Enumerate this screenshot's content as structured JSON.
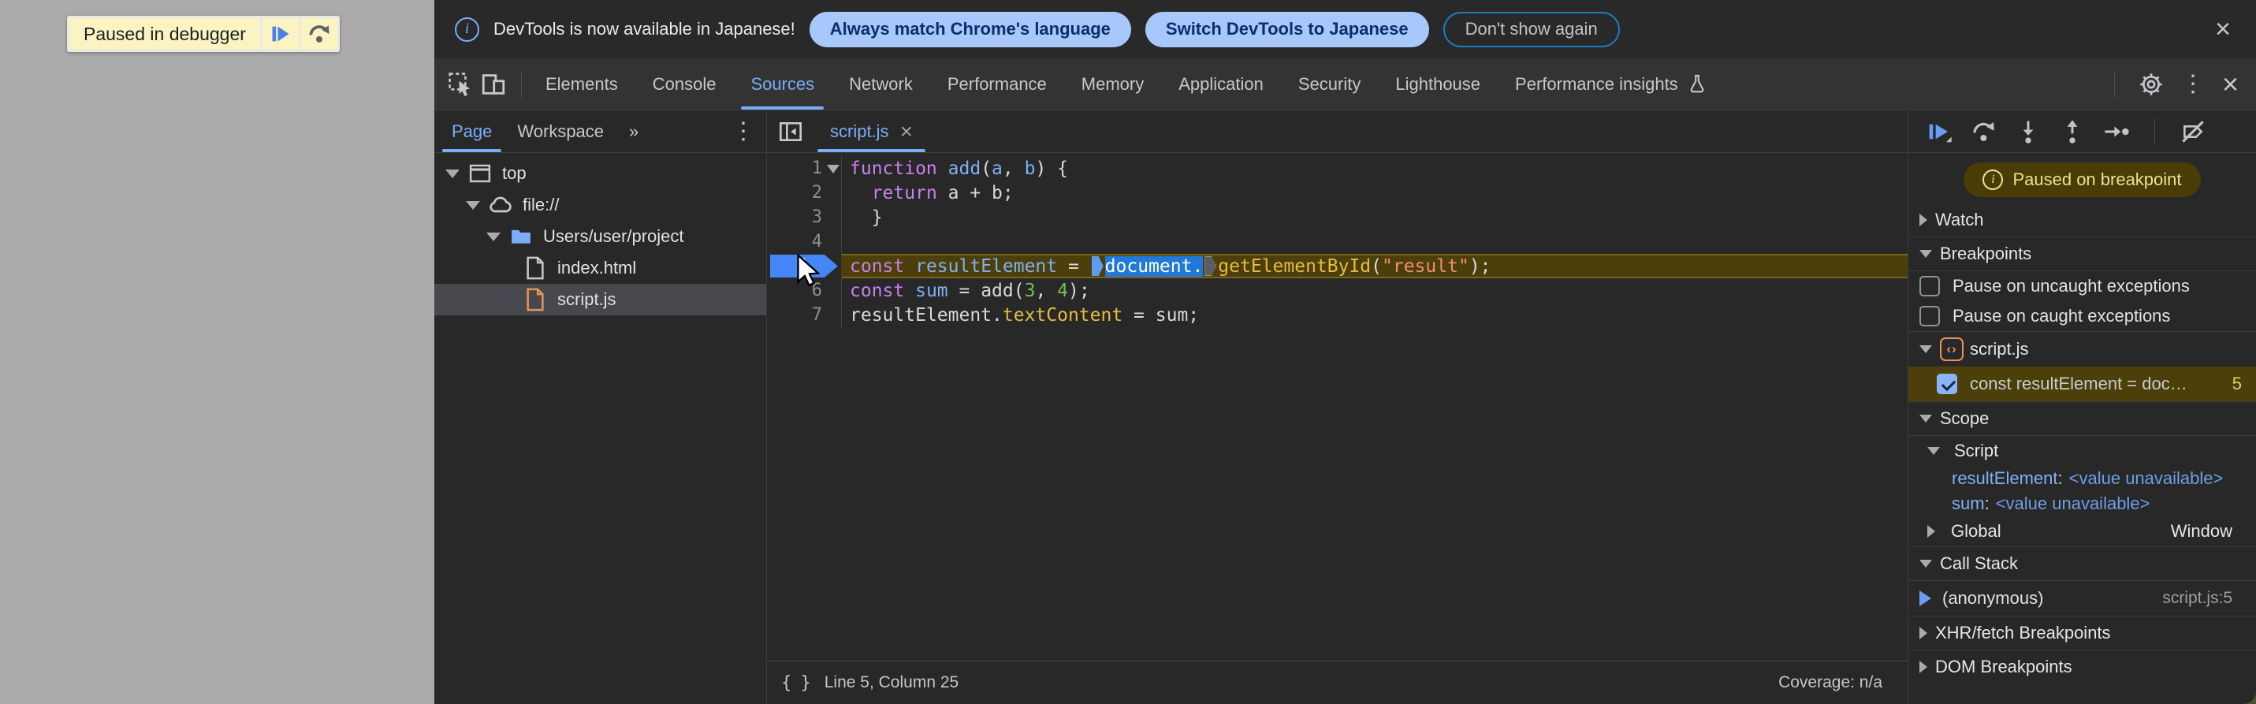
{
  "overlay": {
    "label": "Paused in debugger"
  },
  "infobar": {
    "message": "DevTools is now available in Japanese!",
    "primary_button": "Always match Chrome's language",
    "secondary_button": "Switch DevTools to Japanese",
    "dismiss_button": "Don't show again",
    "close": "×"
  },
  "toolbar": {
    "tabs": [
      "Elements",
      "Console",
      "Sources",
      "Network",
      "Performance",
      "Memory",
      "Application",
      "Security",
      "Lighthouse",
      "Performance insights"
    ],
    "active_tab": "Sources"
  },
  "nav": {
    "page_tab": "Page",
    "workspace_tab": "Workspace",
    "more_tabs": "»",
    "tree": [
      {
        "label": "top",
        "icon": "frame-icon",
        "depth": 0,
        "caret": true,
        "selected": false
      },
      {
        "label": "file://",
        "icon": "cloud-icon",
        "depth": 1,
        "caret": true,
        "selected": false
      },
      {
        "label": "Users/user/project",
        "icon": "folder-icon",
        "depth": 2,
        "caret": true,
        "selected": false
      },
      {
        "label": "index.html",
        "icon": "file-html-icon",
        "depth": 3,
        "caret": false,
        "selected": false
      },
      {
        "label": "script.js",
        "icon": "file-js-icon",
        "depth": 3,
        "caret": false,
        "selected": true
      }
    ]
  },
  "editor": {
    "tab_label": "script.js",
    "status_left": "Line 5, Column 25",
    "status_right": "Coverage: n/a",
    "paused_line": 5,
    "lines": [
      {
        "n": 1,
        "fold": true,
        "paused": false,
        "tokens": [
          [
            "kw",
            "function"
          ],
          [
            "pl",
            " "
          ],
          [
            "def",
            "add"
          ],
          [
            "pl",
            "("
          ],
          [
            "def",
            "a"
          ],
          [
            "pl",
            ", "
          ],
          [
            "def",
            "b"
          ],
          [
            "pl",
            ") {"
          ]
        ]
      },
      {
        "n": 2,
        "fold": false,
        "paused": false,
        "tokens": [
          [
            "pl",
            "  "
          ],
          [
            "kw",
            "return"
          ],
          [
            "pl",
            " a + b;"
          ]
        ]
      },
      {
        "n": 3,
        "fold": false,
        "paused": false,
        "tokens": [
          [
            "pl",
            "  }"
          ]
        ]
      },
      {
        "n": 4,
        "fold": false,
        "paused": false,
        "tokens": []
      },
      {
        "n": 5,
        "fold": false,
        "paused": true,
        "tokens": [
          [
            "kw",
            "const"
          ],
          [
            "pl",
            " "
          ],
          [
            "def",
            "resultElement"
          ],
          [
            "pl",
            " = "
          ],
          [
            "m1",
            ""
          ],
          [
            "sel",
            "document."
          ],
          [
            "m2",
            ""
          ],
          [
            "fn",
            "getElementById"
          ],
          [
            "pl",
            "("
          ],
          [
            "str",
            "\"result\""
          ],
          [
            "pl",
            ");"
          ]
        ]
      },
      {
        "n": 6,
        "fold": false,
        "paused": false,
        "tokens": [
          [
            "kw",
            "const"
          ],
          [
            "pl",
            " "
          ],
          [
            "def",
            "sum"
          ],
          [
            "pl",
            " = add("
          ],
          [
            "num",
            "3"
          ],
          [
            "pl",
            ", "
          ],
          [
            "num",
            "4"
          ],
          [
            "pl",
            ");"
          ]
        ]
      },
      {
        "n": 7,
        "fold": false,
        "paused": false,
        "tokens": [
          [
            "pl",
            "resultElement."
          ],
          [
            "fn",
            "textContent"
          ],
          [
            "pl",
            " = sum;"
          ]
        ]
      }
    ]
  },
  "debugger": {
    "paused_badge": "Paused on breakpoint",
    "watch_label": "Watch",
    "breakpoints_label": "Breakpoints",
    "uncaught_label": "Pause on uncaught exceptions",
    "caught_label": "Pause on caught exceptions",
    "bp_file": "script.js",
    "bp_entry": "const resultElement = doc…",
    "bp_line": "5",
    "scope_label": "Scope",
    "script_scope_label": "Script",
    "vars": [
      {
        "name": "resultElement",
        "value": "<value unavailable>"
      },
      {
        "name": "sum",
        "value": "<value unavailable>"
      }
    ],
    "global_label": "Global",
    "global_value": "Window",
    "callstack_label": "Call Stack",
    "frame_name": "(anonymous)",
    "frame_location": "script.js:5",
    "xhr_label": "XHR/fetch Breakpoints",
    "dom_label": "DOM Breakpoints"
  },
  "colors": {
    "accent_blue": "#7CACF8",
    "paused_line_bg": "#4D3F0A",
    "badge_bg": "#4A3C07",
    "breakpoint_blue": "#4486F6",
    "infobar_button_bg": "#A8C7FA"
  }
}
